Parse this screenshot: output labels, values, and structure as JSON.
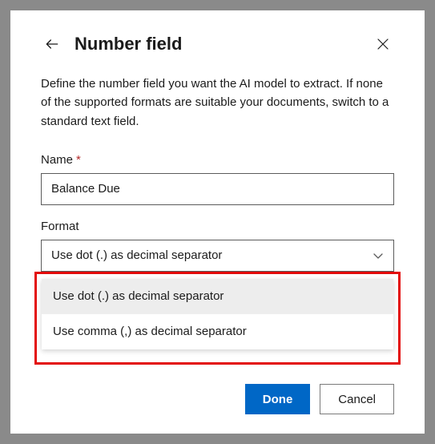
{
  "header": {
    "title": "Number field"
  },
  "description": "Define the number field you want the AI model to extract. If none of the supported formats are suitable your documents, switch to a standard text field.",
  "fields": {
    "name": {
      "label": "Name",
      "required_marker": "*",
      "value": "Balance Due"
    },
    "format": {
      "label": "Format",
      "selected": "Use dot (.) as decimal separator",
      "options": [
        "Use dot (.) as decimal separator",
        "Use comma (,) as decimal separator"
      ]
    }
  },
  "buttons": {
    "done": "Done",
    "cancel": "Cancel"
  },
  "highlight_color": "#e30b0b"
}
